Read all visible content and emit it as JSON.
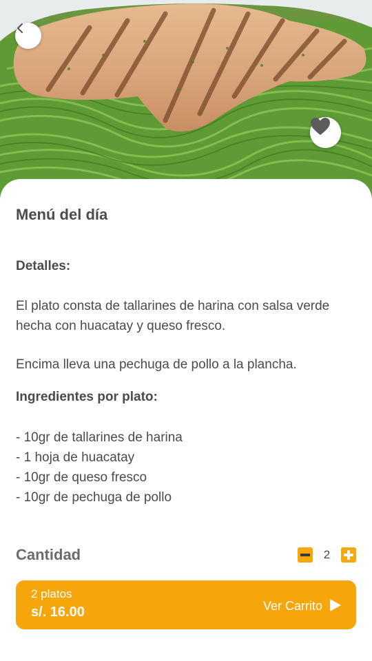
{
  "hero": {
    "back_icon": "chevron-left-icon",
    "favorite_icon": "heart-icon"
  },
  "dish": {
    "title": "Menú del día",
    "details_label": "Detalles:",
    "details_p1": "El plato consta de tallarines de harina con salsa verde hecha con huacatay y queso fresco.",
    "details_p2": "Encima lleva una pechuga de pollo a la plancha.",
    "ingredients_label": "Ingredientes por plato:",
    "ingredients": [
      "- 10gr de tallarines de harina",
      "- 1 hoja de huacatay",
      "- 10gr de queso fresco",
      "- 10gr de pechuga de pollo"
    ]
  },
  "quantity": {
    "label": "Cantidad",
    "value": "2",
    "minus_icon": "minus-icon",
    "plus_icon": "plus-icon"
  },
  "cart": {
    "count_text": "2 platos",
    "price_text": "s/. 16.00",
    "action_label": "Ver Carrito",
    "arrow_icon": "play-arrow-icon"
  },
  "colors": {
    "accent": "#f6a60b",
    "text": "#4a4a4f",
    "background": "#ffffff"
  }
}
